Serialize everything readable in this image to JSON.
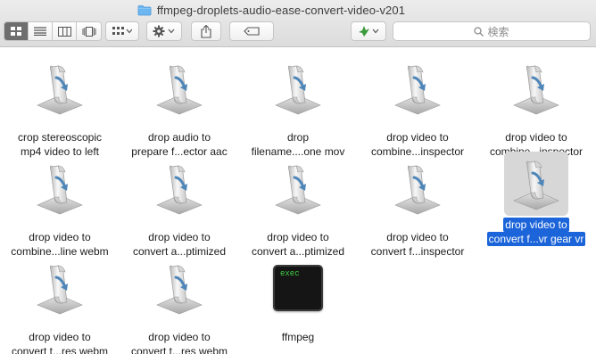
{
  "window": {
    "title": "ffmpeg-droplets-audio-ease-convert-video-v201",
    "folder_icon": "folder-icon"
  },
  "toolbar": {
    "view_modes": [
      "icon-view",
      "list-view",
      "column-view",
      "cover-flow-view"
    ],
    "active_view": "icon-view",
    "arrange_icon": "arrange-grid-icon",
    "action_icon": "gear-icon",
    "share_icon": "share-icon",
    "tags_icon": "tag-icon",
    "dropbox_icon": "bird-icon",
    "search_placeholder": "検索"
  },
  "files": [
    {
      "line1": "crop stereoscopic",
      "line2": "mp4 video to left",
      "kind": "script",
      "selected": false
    },
    {
      "line1": "drop audio to",
      "line2": "prepare f...ector aac",
      "kind": "script",
      "selected": false
    },
    {
      "line1": "drop",
      "line2": "filename....one mov",
      "kind": "script",
      "selected": false
    },
    {
      "line1": "drop video to",
      "line2": "combine...inspector",
      "kind": "script",
      "selected": false
    },
    {
      "line1": "drop video to",
      "line2": "combine...inspector",
      "kind": "script",
      "selected": false
    },
    {
      "line1": "drop video to",
      "line2": "combine...line webm",
      "kind": "script",
      "selected": false
    },
    {
      "line1": "drop video to",
      "line2": "convert a...ptimized",
      "kind": "script",
      "selected": false
    },
    {
      "line1": "drop video to",
      "line2": "convert a...ptimized",
      "kind": "script",
      "selected": false
    },
    {
      "line1": "drop video to",
      "line2": "convert f...inspector",
      "kind": "script",
      "selected": false
    },
    {
      "line1": "drop video to",
      "line2": "convert f...vr gear vr",
      "kind": "script",
      "selected": true
    },
    {
      "line1": "drop video to",
      "line2": "convert t...res webm",
      "kind": "script",
      "selected": false
    },
    {
      "line1": "drop video to",
      "line2": "convert t...res webm",
      "kind": "script",
      "selected": false
    },
    {
      "line1": "ffmpeg",
      "line2": "",
      "kind": "exec",
      "exec_label": "exec",
      "selected": false
    }
  ]
}
